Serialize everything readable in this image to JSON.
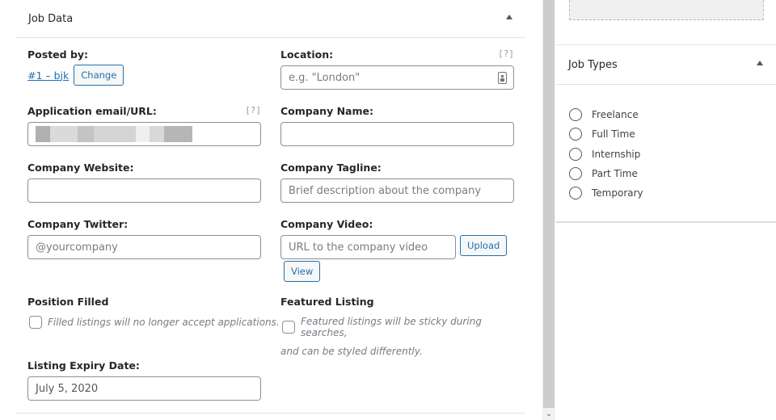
{
  "job_data": {
    "title": "Job Data",
    "posted_by": {
      "label": "Posted by:",
      "user_link": "#1 – bjk",
      "change_button": "Change"
    },
    "location": {
      "label": "Location:",
      "help": "[?]",
      "placeholder": "e.g. \"London\"",
      "value": ""
    },
    "application": {
      "label": "Application email/URL:",
      "help": "[?]",
      "value_redacted": true
    },
    "company_name": {
      "label": "Company Name:",
      "value": ""
    },
    "company_website": {
      "label": "Company Website:",
      "value": ""
    },
    "company_tagline": {
      "label": "Company Tagline:",
      "placeholder": "Brief description about the company"
    },
    "company_twitter": {
      "label": "Company Twitter:",
      "placeholder": "@yourcompany"
    },
    "company_video": {
      "label": "Company Video:",
      "placeholder": "URL to the company video",
      "upload_button": "Upload",
      "view_button": "View"
    },
    "position_filled": {
      "label": "Position Filled",
      "description": "Filled listings will no longer accept applications.",
      "checked": false
    },
    "featured_listing": {
      "label": "Featured Listing",
      "description_line1": "Featured listings will be sticky during searches,",
      "description_line2": "and can be styled differently.",
      "checked": false
    },
    "expiry": {
      "label": "Listing Expiry Date:",
      "value": "July 5, 2020"
    }
  },
  "job_types": {
    "title": "Job Types",
    "options": [
      {
        "label": "Freelance",
        "selected": false
      },
      {
        "label": "Full Time",
        "selected": false
      },
      {
        "label": "Internship",
        "selected": false
      },
      {
        "label": "Part Time",
        "selected": false
      },
      {
        "label": "Temporary",
        "selected": false
      }
    ]
  }
}
